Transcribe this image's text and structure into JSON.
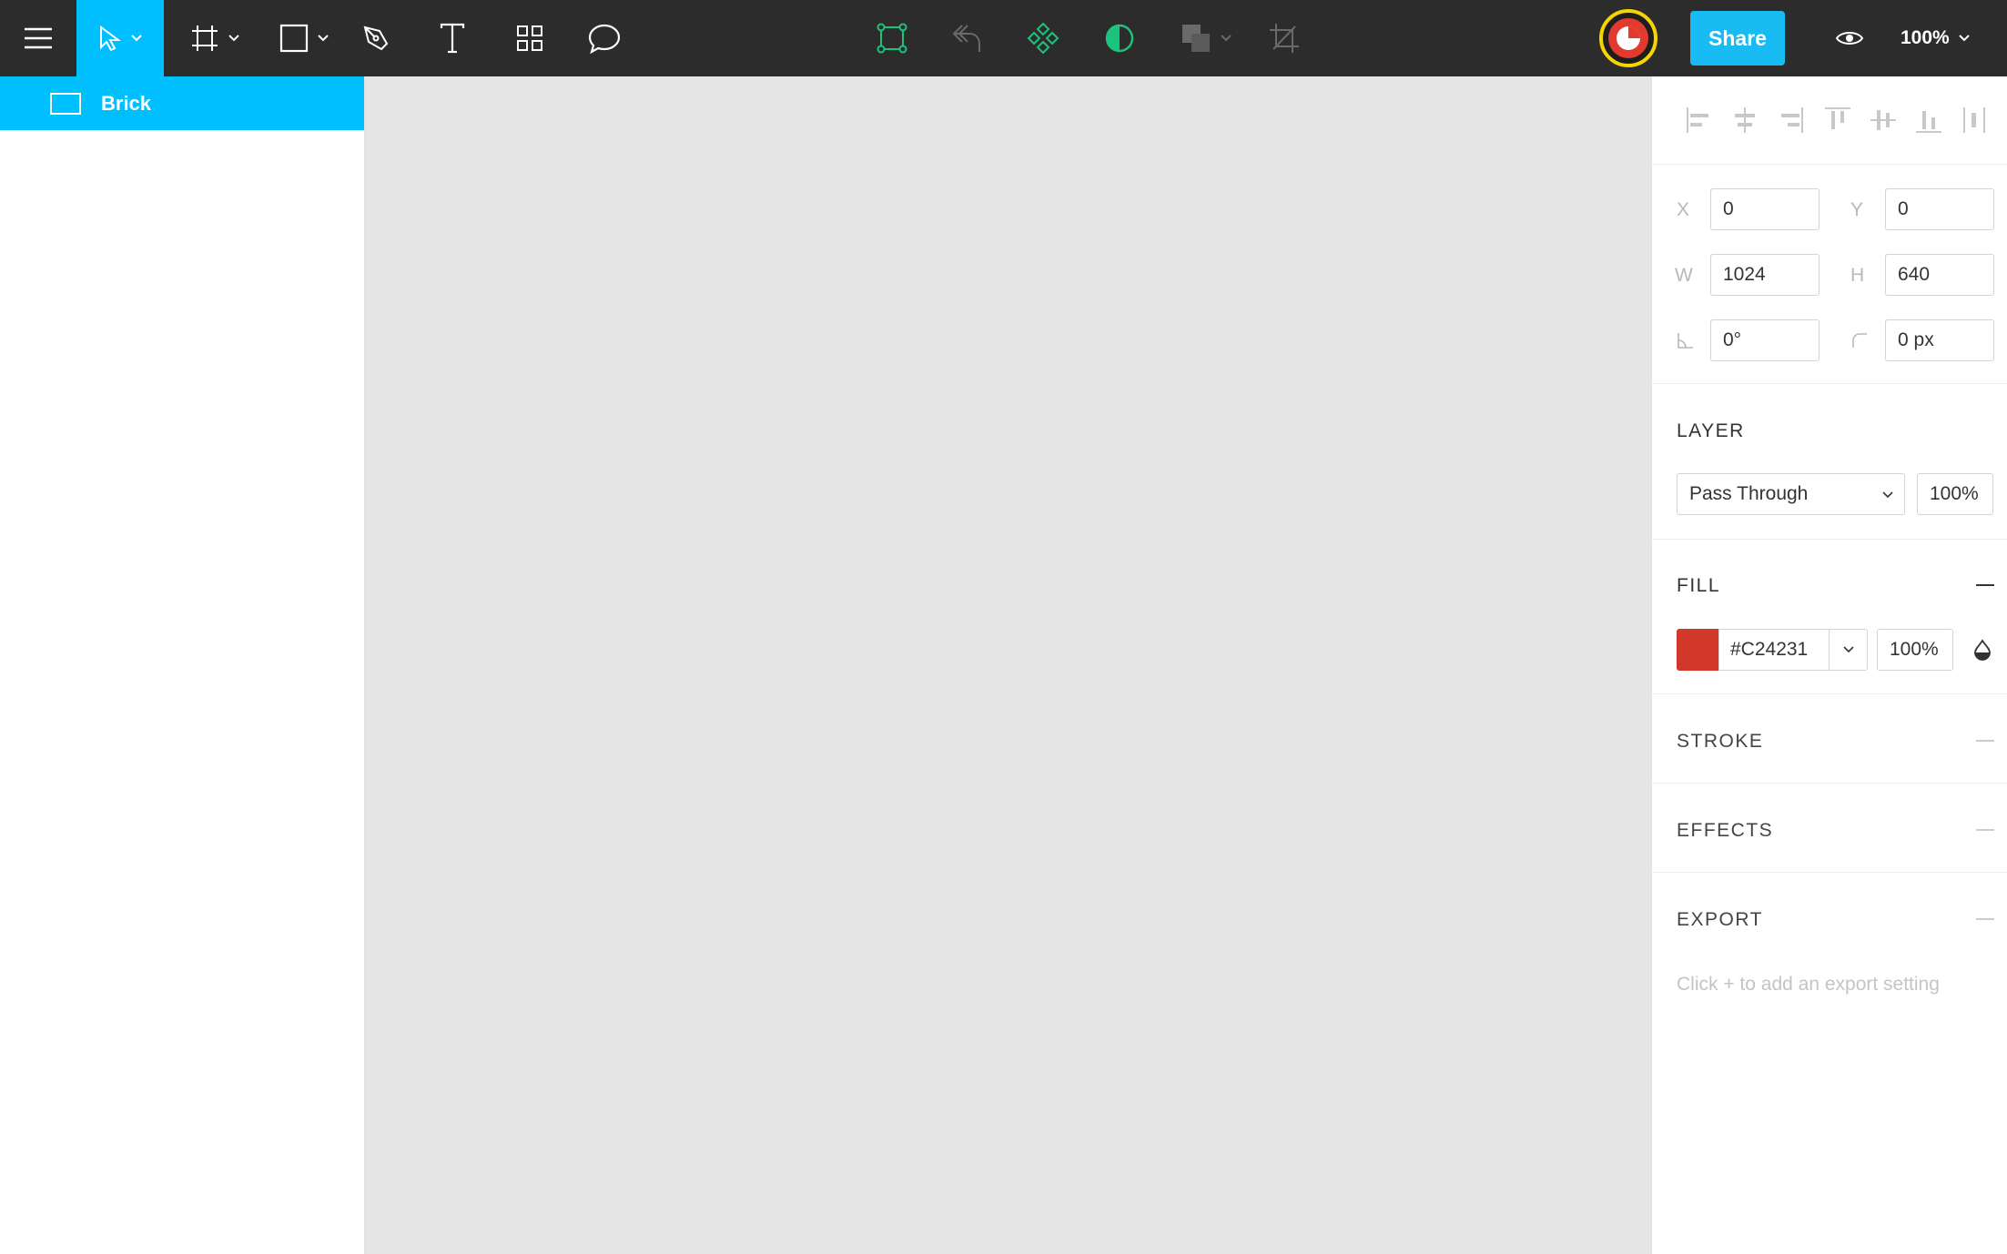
{
  "toolbar": {
    "tools": [
      "menu-icon",
      "move-tool",
      "frame-tool",
      "shape-tool",
      "pen-tool",
      "text-tool",
      "components-tool",
      "comment-tool"
    ],
    "center_tools": [
      "edit-object-icon",
      "undo-icon",
      "component-icon",
      "mask-icon",
      "boolean-icon",
      "crop-icon"
    ],
    "share_label": "Share",
    "zoom_label": "100%",
    "colors": {
      "bg": "#2c2c2c",
      "active": "#00bfff",
      "share": "#18bcf2",
      "green": "#1bc47d"
    }
  },
  "layers": {
    "items": [
      {
        "name": "Brick",
        "selected": true
      }
    ]
  },
  "props": {
    "x_label": "X",
    "x_value": "0",
    "y_label": "Y",
    "y_value": "0",
    "w_label": "W",
    "w_value": "1024",
    "h_label": "H",
    "h_value": "640",
    "rotation_value": "0°",
    "radius_value": "0 px",
    "layer_title": "LAYER",
    "blend_mode": "Pass Through",
    "layer_opacity": "100%",
    "fill_title": "FILL",
    "fill_hex": "#C24231",
    "fill_opacity": "100%",
    "fill_color": "#d2382a",
    "stroke_title": "STROKE",
    "effects_title": "EFFECTS",
    "export_title": "EXPORT",
    "export_hint": "Click + to add an export setting"
  }
}
